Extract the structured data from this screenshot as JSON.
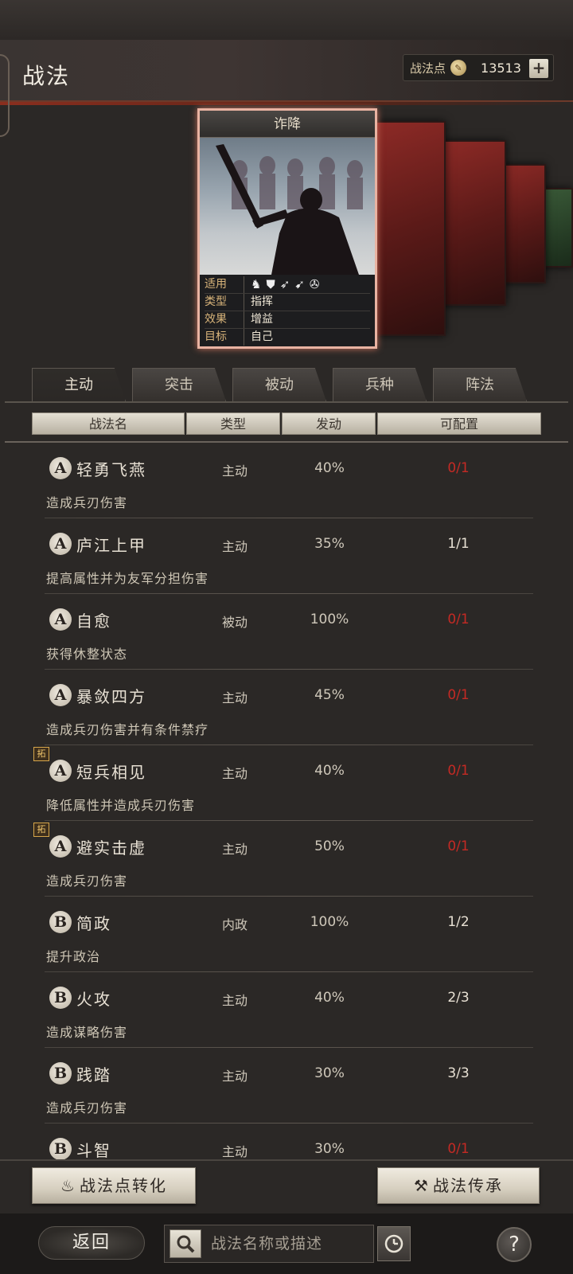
{
  "header": {
    "title": "战法",
    "points_label": "战法点",
    "points_value": "13513",
    "plus_icon": "plus-icon"
  },
  "card": {
    "name": "诈降",
    "stats": [
      {
        "key": "适用",
        "value": ""
      },
      {
        "key": "类型",
        "value": "指挥"
      },
      {
        "key": "效果",
        "value": "增益"
      },
      {
        "key": "目标",
        "value": "自己"
      }
    ],
    "apply_icons": [
      "cavalry-icon",
      "shield-icon",
      "bow-icon",
      "spear-icon",
      "wheel-icon"
    ]
  },
  "tabs": [
    {
      "label": "主动"
    },
    {
      "label": "突击"
    },
    {
      "label": "被动"
    },
    {
      "label": "兵种"
    },
    {
      "label": "阵法"
    }
  ],
  "columns": {
    "name": "战法名",
    "type": "类型",
    "rate": "发动",
    "avail": "可配置"
  },
  "tactics": [
    {
      "grade": "A",
      "name": "轻勇飞燕",
      "type": "主动",
      "rate": "40%",
      "avail": "0/1",
      "avail_color": "#c42a24",
      "desc": "造成兵刃伤害",
      "badge": ""
    },
    {
      "grade": "A",
      "name": "庐江上甲",
      "type": "主动",
      "rate": "35%",
      "avail": "1/1",
      "avail_color": "#e8e1d4",
      "desc": "提高属性并为友军分担伤害",
      "badge": ""
    },
    {
      "grade": "A",
      "name": "自愈",
      "type": "被动",
      "rate": "100%",
      "avail": "0/1",
      "avail_color": "#c42a24",
      "desc": "获得休整状态",
      "badge": ""
    },
    {
      "grade": "A",
      "name": "暴敛四方",
      "type": "主动",
      "rate": "45%",
      "avail": "0/1",
      "avail_color": "#c42a24",
      "desc": "造成兵刃伤害并有条件禁疗",
      "badge": ""
    },
    {
      "grade": "A",
      "name": "短兵相见",
      "type": "主动",
      "rate": "40%",
      "avail": "0/1",
      "avail_color": "#c42a24",
      "desc": "降低属性并造成兵刃伤害",
      "badge": "拓"
    },
    {
      "grade": "A",
      "name": "避实击虚",
      "type": "主动",
      "rate": "50%",
      "avail": "0/1",
      "avail_color": "#c42a24",
      "desc": "造成兵刃伤害",
      "badge": "拓"
    },
    {
      "grade": "B",
      "name": "简政",
      "type": "内政",
      "rate": "100%",
      "avail": "1/2",
      "avail_color": "#e8e1d4",
      "desc": "提升政治",
      "badge": ""
    },
    {
      "grade": "B",
      "name": "火攻",
      "type": "主动",
      "rate": "40%",
      "avail": "2/3",
      "avail_color": "#e8e1d4",
      "desc": "造成谋略伤害",
      "badge": ""
    },
    {
      "grade": "B",
      "name": "践踏",
      "type": "主动",
      "rate": "30%",
      "avail": "3/3",
      "avail_color": "#e8e1d4",
      "desc": "造成兵刃伤害",
      "badge": ""
    },
    {
      "grade": "B",
      "name": "斗智",
      "type": "主动",
      "rate": "30%",
      "avail": "0/1",
      "avail_color": "#c42a24",
      "desc": "",
      "badge": ""
    }
  ],
  "buttons": {
    "convert": "战法点转化",
    "inherit": "战法传承"
  },
  "footer": {
    "back": "返回",
    "search_placeholder": "战法名称或描述",
    "help": "?"
  }
}
